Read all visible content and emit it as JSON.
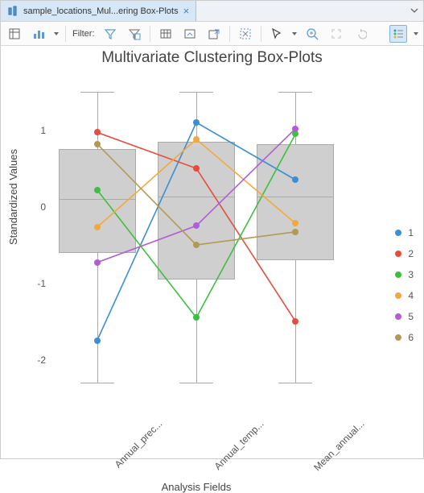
{
  "tab": {
    "title": "sample_locations_Mul...ering Box-Plots",
    "close": "×"
  },
  "toolbar": {
    "filter_label": "Filter:"
  },
  "chart_data": {
    "type": "boxplot-overlay",
    "title": "Multivariate Clustering Box-Plots",
    "xlabel": "Analysis Fields",
    "ylabel": "Standardized Values",
    "ylim": [
      -2.7,
      1.7
    ],
    "yticks": [
      -2,
      -1,
      0,
      1
    ],
    "categories": [
      "Annual_prec...",
      "Annual_temp...",
      "Mean_annual..."
    ],
    "boxes": [
      {
        "min": -2.3,
        "q1": -0.6,
        "median": 0.1,
        "q3": 0.75,
        "max": 1.5
      },
      {
        "min": -2.3,
        "q1": -0.95,
        "median": 0.13,
        "q3": 0.85,
        "max": 1.5
      },
      {
        "min": -2.3,
        "q1": -0.7,
        "median": 0.13,
        "q3": 0.82,
        "max": 1.5
      }
    ],
    "series": [
      {
        "name": "1",
        "color": "#3b8fd6",
        "values": [
          -1.75,
          1.1,
          0.35
        ]
      },
      {
        "name": "2",
        "color": "#e84c3d",
        "values": [
          0.97,
          0.5,
          -1.5
        ]
      },
      {
        "name": "3",
        "color": "#3fbf3f",
        "values": [
          0.22,
          -1.45,
          0.95
        ]
      },
      {
        "name": "4",
        "color": "#f2a93b",
        "values": [
          -0.27,
          0.88,
          -0.22
        ]
      },
      {
        "name": "5",
        "color": "#b25dd6",
        "values": [
          -0.73,
          -0.25,
          1.02
        ]
      },
      {
        "name": "6",
        "color": "#b29a56",
        "values": [
          0.82,
          -0.5,
          -0.33
        ]
      }
    ]
  },
  "legend": [
    {
      "label": "1",
      "color": "#3b8fd6"
    },
    {
      "label": "2",
      "color": "#e84c3d"
    },
    {
      "label": "3",
      "color": "#3fbf3f"
    },
    {
      "label": "4",
      "color": "#f2a93b"
    },
    {
      "label": "5",
      "color": "#b25dd6"
    },
    {
      "label": "6",
      "color": "#b29a56"
    }
  ]
}
